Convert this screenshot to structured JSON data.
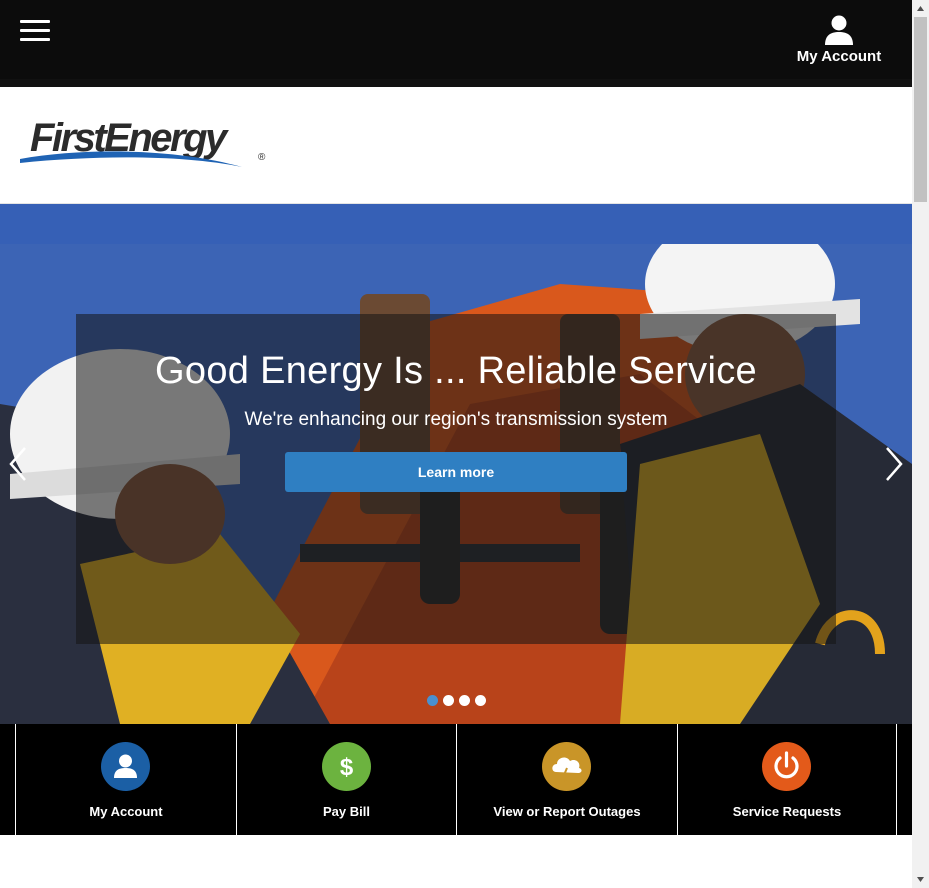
{
  "header": {
    "menu_icon": "hamburger-menu-icon",
    "account_label": "My Account",
    "account_icon": "user-icon"
  },
  "logo": {
    "text": "FirstEnergy",
    "registered": "®",
    "brand_color": "#2b2b2b",
    "swoosh_color": "#1f63b4"
  },
  "hero": {
    "title": "Good Energy Is ... Reliable Service",
    "subtitle": "We're enhancing our region's transmission system",
    "button_label": "Learn more",
    "button_color": "#2f7fc2",
    "prev_icon": "chevron-left-icon",
    "next_icon": "chevron-right-icon",
    "slide_count": 4,
    "active_slide": 1
  },
  "quick_links": [
    {
      "label": "My Account",
      "icon": "user-icon",
      "color": "#1b5fa5"
    },
    {
      "label": "Pay Bill",
      "icon": "dollar-icon",
      "color": "#6cb33f"
    },
    {
      "label": "View or Report Outages",
      "icon": "storm-cloud-icon",
      "color": "#c99528"
    },
    {
      "label": "Service Requests",
      "icon": "power-icon",
      "color": "#e35a1a"
    }
  ]
}
